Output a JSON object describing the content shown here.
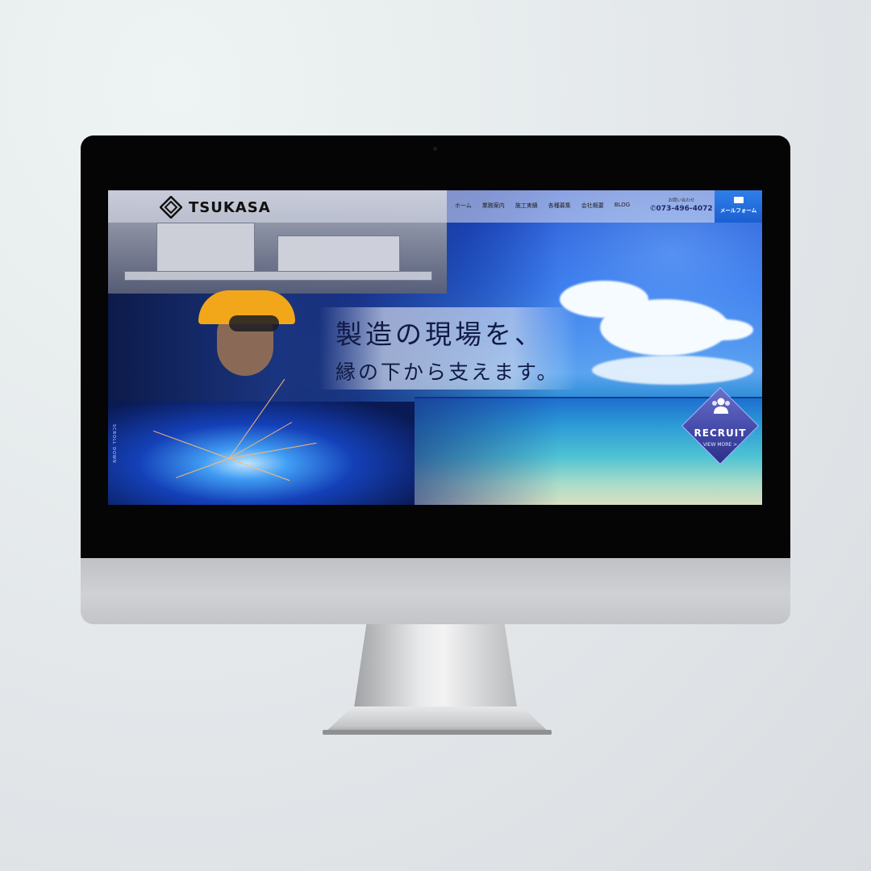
{
  "site": {
    "logo_text": "TSUKASA",
    "nav": [
      "ホーム",
      "業務案内",
      "施工実績",
      "各種募集",
      "会社概要",
      "BLOG"
    ],
    "contact_label": "お問い合わせ",
    "phone": "073-496-4072",
    "mail_button": "メールフォーム"
  },
  "hero": {
    "headline_line1": "製造の現場を、",
    "headline_line2": "縁の下から支えます。",
    "scroll_text": "SCROLL DOWN"
  },
  "recruit": {
    "title": "RECRUIT",
    "more": "VIEW MORE >"
  },
  "icons": [
    "logo-mark-icon",
    "phone-icon",
    "mail-icon",
    "people-icon",
    "camera-icon"
  ],
  "colors": {
    "accent": "#1b5fd1",
    "headline": "#101a44",
    "badge": "#4047a5",
    "bezel": "#050505"
  }
}
